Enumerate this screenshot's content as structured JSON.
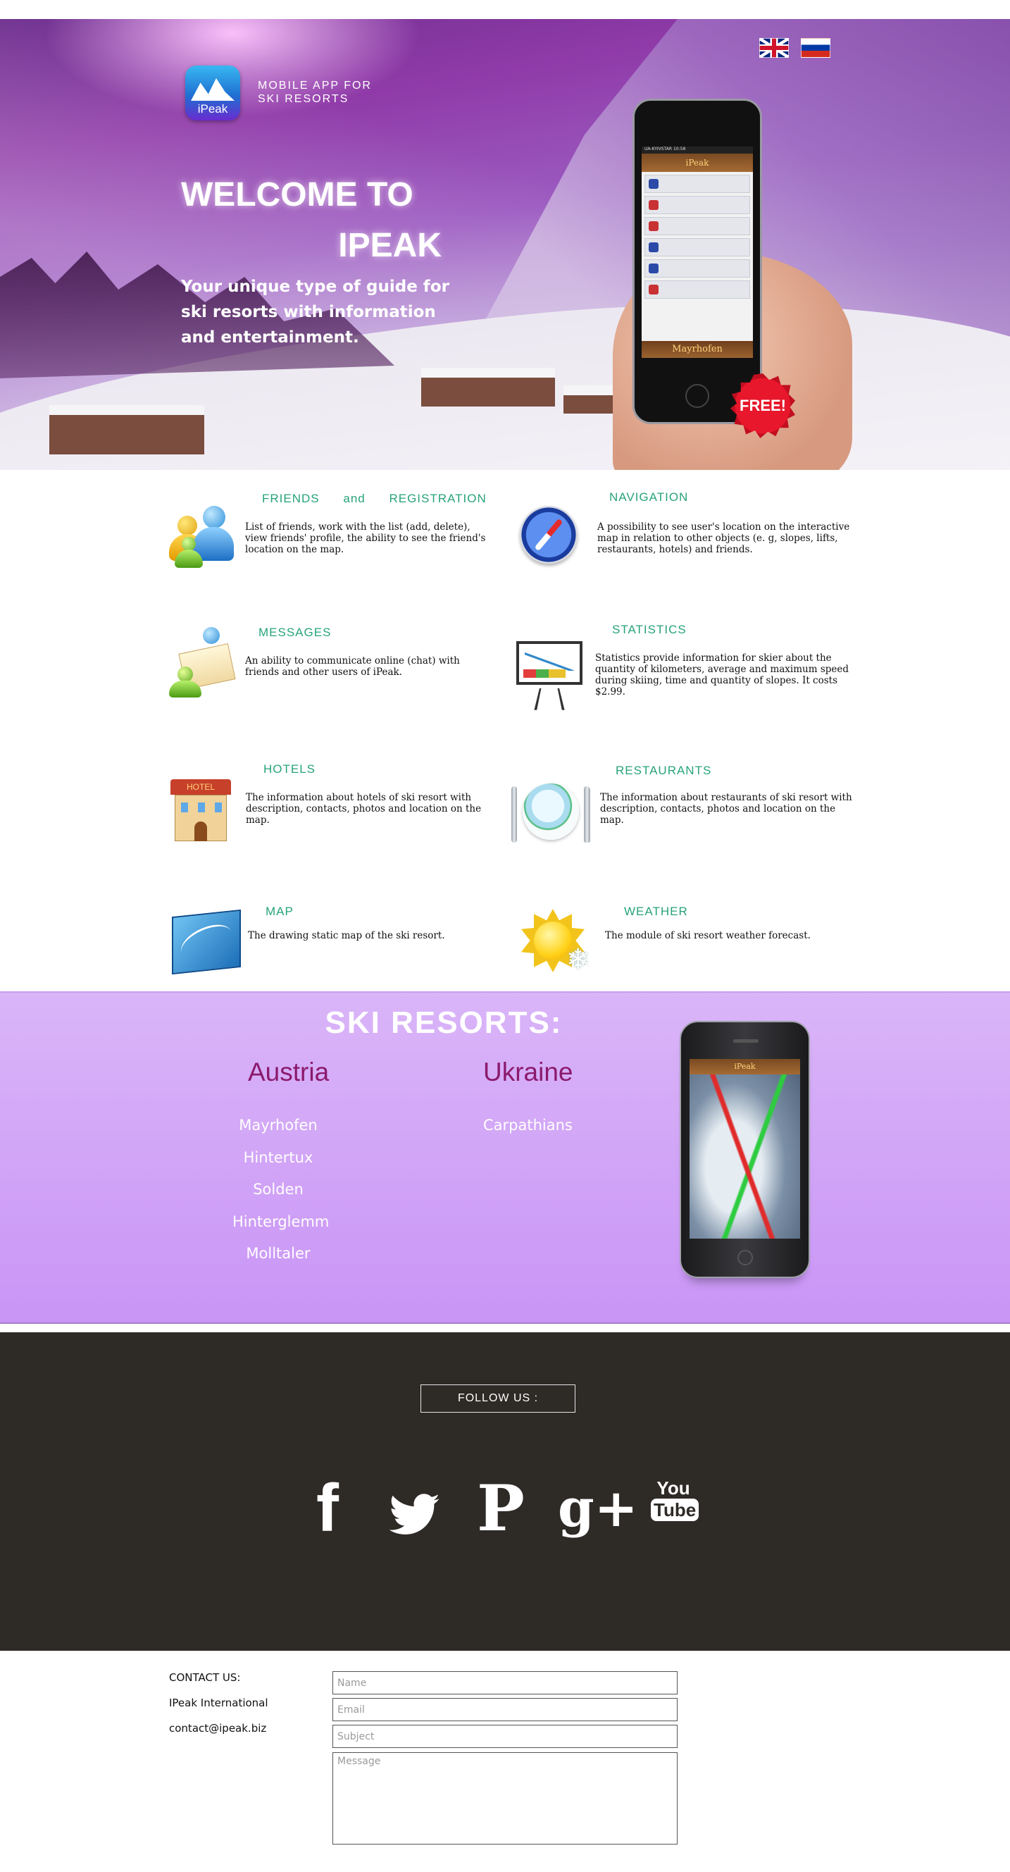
{
  "hero": {
    "tagline_line1": "MOBILE APP FOR",
    "tagline_line2": "SKI RESORTS",
    "app_icon_label": "iPeak",
    "welcome_line1": "WELCOME TO",
    "welcome_line2": "IPEAK",
    "description": "Your unique type of guide for ski resorts with information and entertainment.",
    "free_badge": "FREE!",
    "phone_header": "iPeak",
    "phone_footer": "Mayrhofen",
    "phone_status": "UA-KYIVSTAR 10:58"
  },
  "languages": [
    {
      "code": "en",
      "name": "English"
    },
    {
      "code": "ru",
      "name": "Russian"
    }
  ],
  "features": {
    "friends": {
      "title_a": "FRIENDS",
      "title_and": "and",
      "title_b": "REGISTRATION",
      "text": "List of friends, work with the list (add, delete), view friends' profile, the ability to see the friend's location on the map."
    },
    "navigation": {
      "title": "NAVIGATION",
      "text": "A possibility to see user's location on the interactive map in relation to other objects (e. g, slopes, lifts, restaurants, hotels) and friends."
    },
    "messages": {
      "title": "MESSAGES",
      "text": "An ability to communicate online (chat) with friends and other users of iPeak."
    },
    "statistics": {
      "title": "STATISTICS",
      "text": "Statistics provide information for skier about the quantity of kilometers, average and maximum speed during skiing, time and quantity of slopes. It costs $2.99."
    },
    "hotels": {
      "title": "HOTELS",
      "text": "The information about hotels of ski resort with description, contacts, photos and location on the map.",
      "icon_label": "HOTEL"
    },
    "restaurants": {
      "title": "RESTAURANTS",
      "text": "The information about restaurants of ski resort with description, contacts, photos and location on the map."
    },
    "map": {
      "title": "MAP",
      "text": "The drawing static map of the ski resort."
    },
    "weather": {
      "title": "WEATHER",
      "text": "The module of ski resort weather forecast."
    }
  },
  "resorts": {
    "title": "SKI RESORTS:",
    "countries": [
      {
        "name": "Austria",
        "resorts": [
          "Mayrhofen",
          "Hintertux",
          "Solden",
          "Hinterglemm",
          "Molltaler"
        ]
      },
      {
        "name": "Ukraine",
        "resorts": [
          "Carpathians"
        ]
      }
    ],
    "phone_header": "iPeak"
  },
  "follow": {
    "label": "FOLLOW US :",
    "networks": [
      "facebook",
      "twitter",
      "pinterest",
      "google-plus",
      "youtube"
    ],
    "fb_glyph": "f",
    "pin_glyph": "P",
    "gplus_glyph": "g+",
    "yt_you": "You",
    "yt_tube": "Tube"
  },
  "contact": {
    "heading": "CONTACT US:",
    "company": "IPeak International",
    "email": "contact@ipeak.biz",
    "name_placeholder": "Name",
    "email_placeholder": "Email",
    "subject_placeholder": "Subject",
    "message_placeholder": "Message"
  },
  "colors": {
    "feature_title": "#27a37a",
    "resorts_bg": "#c995f6",
    "country_name": "#8b1a6c",
    "footer_bg": "#2e2a26"
  }
}
